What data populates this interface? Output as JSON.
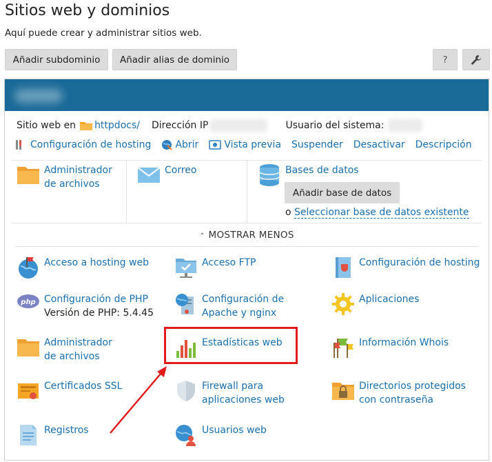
{
  "header": {
    "title": "Sitios web y dominios",
    "subtitle": "Aquí puede crear y administrar sitios web."
  },
  "toolbar": {
    "add_subdomain": "Añadir subdominio",
    "add_alias": "Añadir alias de dominio",
    "help": "?",
    "tools_icon": "wrench-icon"
  },
  "site": {
    "website_label": "Sitio web en",
    "docroot": "httpdocs/",
    "ip_label": "Dirección IP",
    "user_label": "Usuario del sistema:"
  },
  "actions": [
    {
      "label": "Configuración de hosting",
      "icon": "hosting-settings-icon"
    },
    {
      "label": "Abrir",
      "icon": "globe-open-icon"
    },
    {
      "label": "Vista previa",
      "icon": "preview-icon"
    },
    {
      "label": "Suspender"
    },
    {
      "label": "Desactivar"
    },
    {
      "label": "Descripción"
    }
  ],
  "quick": {
    "file_manager": "Administrador de archivos",
    "mail": "Correo",
    "databases": "Bases de datos",
    "add_db": "Añadir base de datos",
    "or": "o",
    "select_db": "Seleccionar base de datos existente"
  },
  "toggle": {
    "label": "MOSTRAR MENOS"
  },
  "tools": {
    "web_hosting_access": "Acceso a hosting web",
    "ftp_access": "Acceso FTP",
    "hosting_settings": "Configuración de hosting",
    "php_settings": "Configuración de PHP",
    "php_version": "Versión de PHP: 5.4.45",
    "apache_nginx": "Configuración de Apache y nginx",
    "applications": "Aplicaciones",
    "file_manager": "Administrador de archivos",
    "web_stats": "Estadísticas web",
    "whois": "Información Whois",
    "ssl": "Certificados SSL",
    "firewall": "Firewall para aplicaciones web",
    "protected_dirs": "Directorios protegidos con contraseña",
    "logs": "Registros",
    "web_users": "Usuarios web"
  },
  "colors": {
    "header_bar": "#1a6a98",
    "link": "#1b70b0",
    "highlight": "#e11b1b",
    "button_bg": "#dcdcdc"
  }
}
